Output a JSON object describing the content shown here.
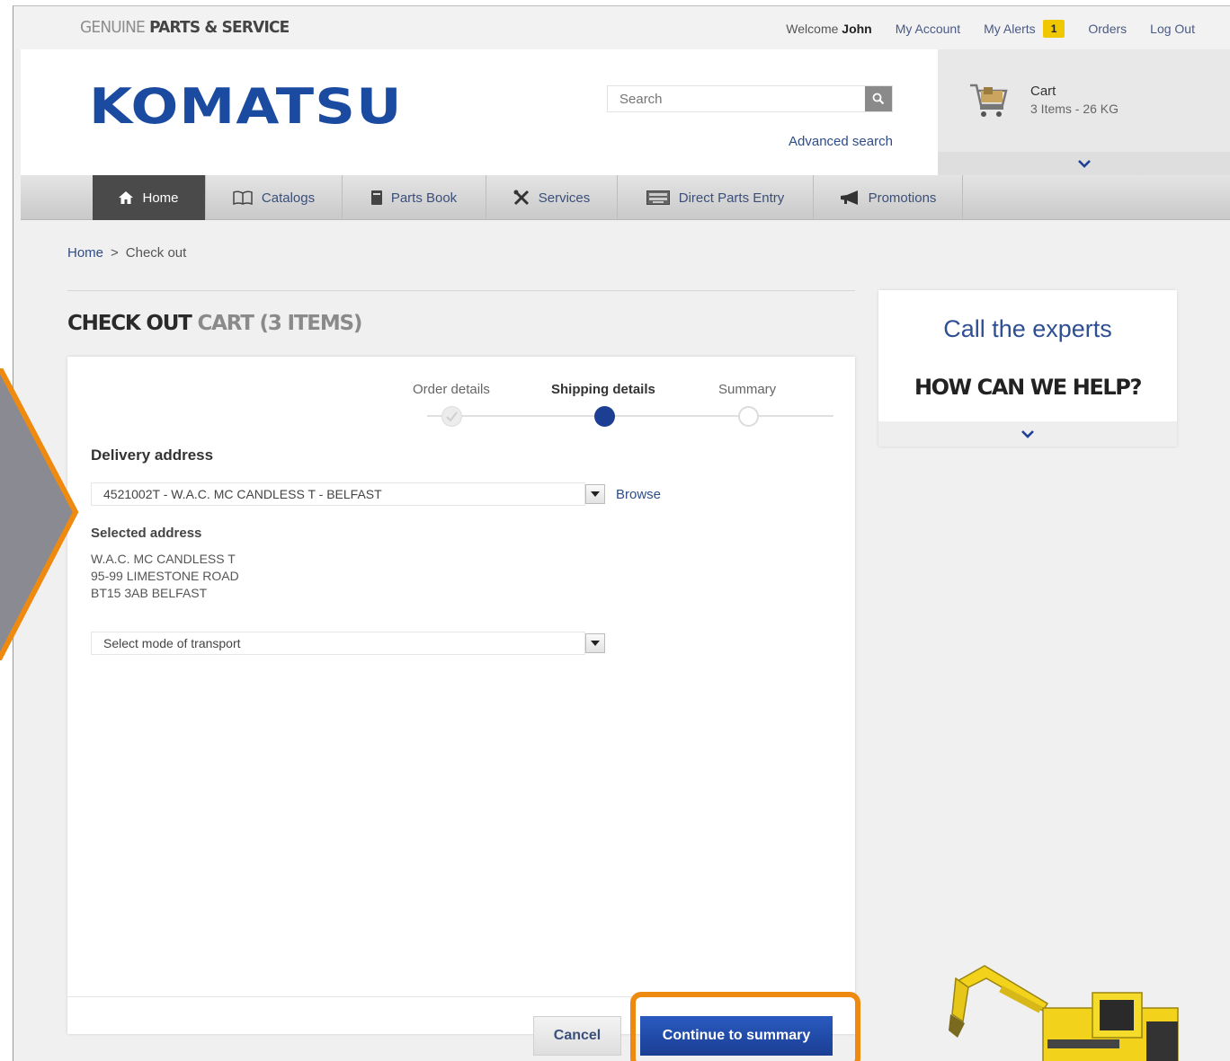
{
  "topbar": {
    "brand_genuine": "GENUINE",
    "brand_parts": "PARTS & SERVICE",
    "welcome_prefix": "Welcome",
    "user_name": "John",
    "my_account": "My Account",
    "my_alerts": "My Alerts",
    "alerts_count": "1",
    "orders": "Orders",
    "logout": "Log Out"
  },
  "header": {
    "logo_text": "KOMATSU",
    "search_placeholder": "Search",
    "advanced_search": "Advanced search",
    "search_icon": "magnifier-icon"
  },
  "cart": {
    "title": "Cart",
    "summary": "3 Items - 26 KG",
    "icon": "shopping-cart-icon",
    "expand_icon": "chevron-down-icon"
  },
  "nav": {
    "items": [
      {
        "label": "Home",
        "icon": "home-icon",
        "active": true
      },
      {
        "label": "Catalogs",
        "icon": "open-book-icon"
      },
      {
        "label": "Parts Book",
        "icon": "book-icon"
      },
      {
        "label": "Services",
        "icon": "tools-icon"
      },
      {
        "label": "Direct Parts Entry",
        "icon": "keyboard-icon"
      },
      {
        "label": "Promotions",
        "icon": "megaphone-icon"
      }
    ]
  },
  "breadcrumb": {
    "home": "Home",
    "separator": ">",
    "current": "Check out"
  },
  "page": {
    "title_main": "CHECK OUT",
    "title_sub": "CART (3 ITEMS)"
  },
  "steps": {
    "items": [
      {
        "label": "Order details",
        "state": "done"
      },
      {
        "label": "Shipping details",
        "state": "current"
      },
      {
        "label": "Summary",
        "state": "todo"
      }
    ]
  },
  "form": {
    "delivery_label": "Delivery address",
    "delivery_value": "4521002T - W.A.C. MC CANDLESS T - BELFAST",
    "browse": "Browse",
    "selected_label": "Selected address",
    "address_line1": "W.A.C. MC CANDLESS T",
    "address_line2": "95-99 LIMESTONE ROAD",
    "address_line3": "BT15 3AB BELFAST",
    "transport_placeholder": "Select mode of transport"
  },
  "help": {
    "line1": "Call the experts",
    "line2": "HOW CAN WE HELP?",
    "expand_icon": "chevron-down-icon"
  },
  "actions": {
    "cancel": "Cancel",
    "continue": "Continue to summary"
  },
  "colors": {
    "brand_blue": "#1a4ba0",
    "primary_button": "#1d3f93",
    "highlight_orange": "#ee8a10",
    "alert_badge": "#f0c800"
  }
}
